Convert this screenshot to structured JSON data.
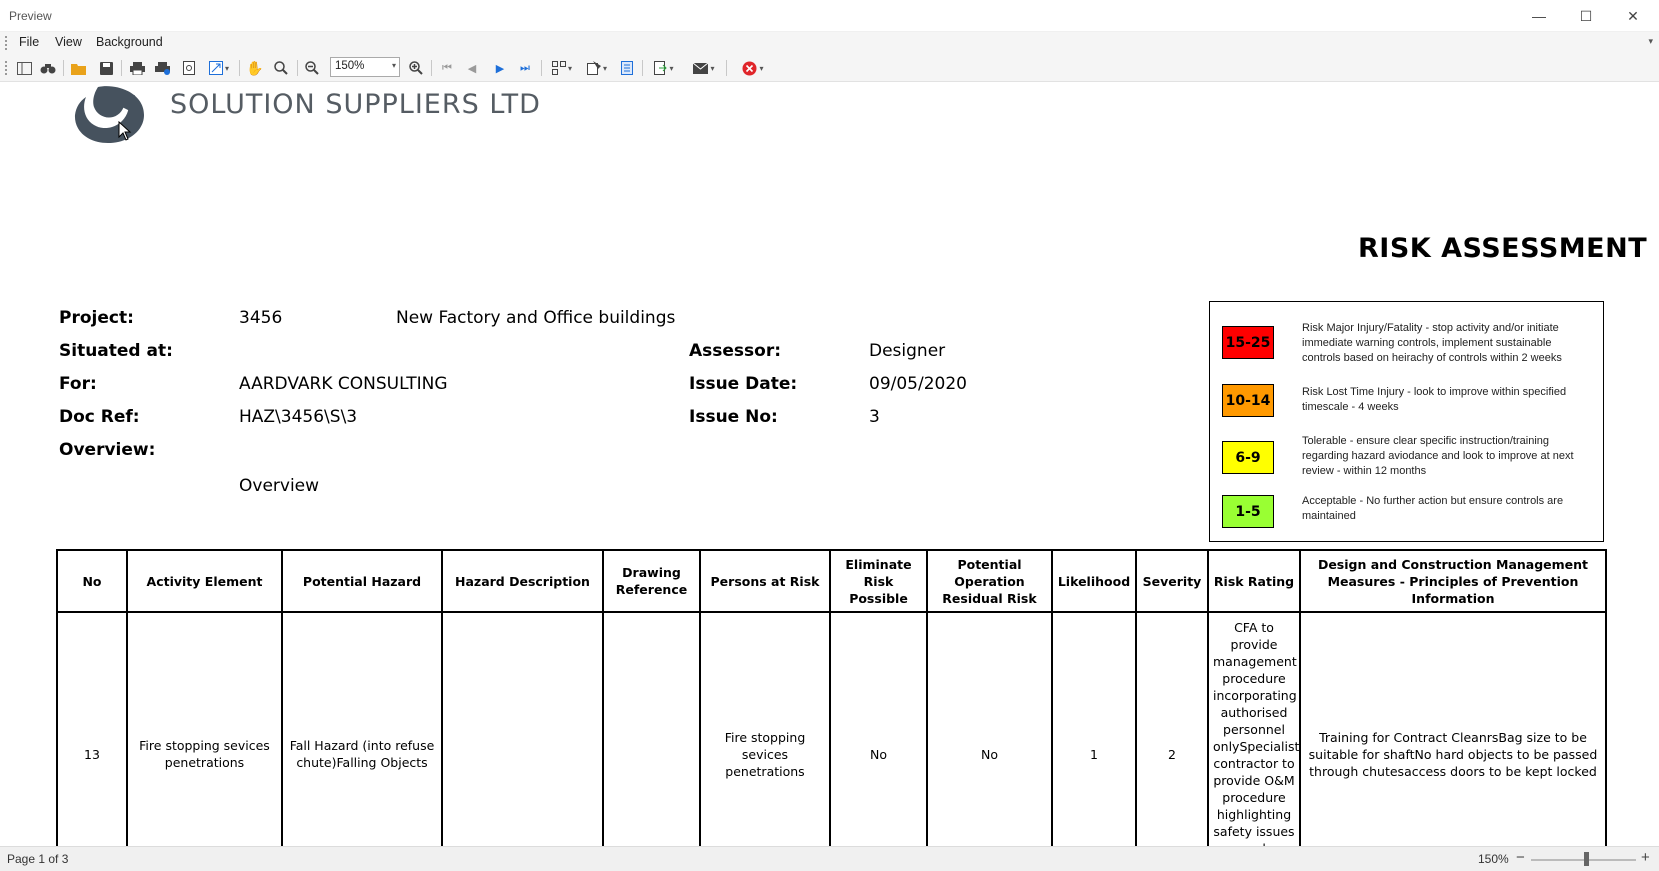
{
  "window": {
    "title": "Preview",
    "minimize_label": "—",
    "maximize_label": "☐",
    "close_label": "✕"
  },
  "menu": {
    "items": [
      "File",
      "View",
      "Background"
    ],
    "overflow": "▾"
  },
  "toolbar": {
    "zoom_value": "150%"
  },
  "document": {
    "company_name": "SOLUTION SUPPLIERS LTD",
    "report_title": "RISK ASSESSMENT",
    "fields": {
      "project_label": "Project:",
      "project_number": "3456",
      "project_name": "New Factory and Office buildings",
      "situated_label": "Situated at:",
      "for_label": "For:",
      "for_value": "AARDVARK CONSULTING",
      "docref_label": "Doc Ref:",
      "docref_value": "HAZ\\3456\\S\\3",
      "overview_label": "Overview:",
      "overview_value": "Overview",
      "assessor_label": "Assessor:",
      "assessor_value": "Designer",
      "issue_date_label": "Issue Date:",
      "issue_date_value": "09/05/2020",
      "issue_no_label": "Issue No:",
      "issue_no_value": "3"
    },
    "legend": [
      {
        "range": "15-25",
        "color": "#ff0000",
        "text": "Risk Major Injury/Fatality - stop activity and/or initiate immediate warning controls, implement sustainable controls based on heirachy of controls within 2 weeks"
      },
      {
        "range": "10-14",
        "color": "#ff9900",
        "text": "Risk Lost Time Injury - look to improve within specified timescale - 4 weeks"
      },
      {
        "range": "6-9",
        "color": "#ffff00",
        "text": "Tolerable - ensure clear specific instruction/training regarding hazard aviodance and look to improve at next review - within 12 months"
      },
      {
        "range": "1-5",
        "color": "#99ff33",
        "text": "Acceptable - No further action but ensure controls are maintained"
      }
    ],
    "table": {
      "headers": [
        "No",
        "Activity Element",
        "Potential Hazard",
        "Hazard Description",
        "Drawing Reference",
        "Persons at Risk",
        "Eliminate Risk Possible",
        "Potential Operation Residual Risk",
        "Likelihood",
        "Severity",
        "Risk Rating",
        "Design and Construction Management Measures - Principles of Prevention Information"
      ],
      "rows": [
        {
          "no": "13",
          "activity": "Fire stopping sevices penetrations",
          "hazard": "Fall Hazard (into refuse chute)Falling Objects",
          "description": "",
          "drawing": "",
          "persons": "Fire stopping sevices penetrations",
          "eliminate": "No",
          "residual": "No",
          "likelihood": "1",
          "severity": "2",
          "rating": "CFA to provide management procedure incorporating authorised personnel onlySpecialist contractor to provide O&M procedure highlighting safety issues and induction training",
          "measures": "Training for Contract CleanrsBag size to be suitable for shaftNo hard objects to be passed through chutesaccess doors to be kept locked"
        }
      ]
    }
  },
  "status": {
    "page": "Page 1 of 3",
    "zoom": "150%",
    "zoom_level_fraction": 0.52
  }
}
